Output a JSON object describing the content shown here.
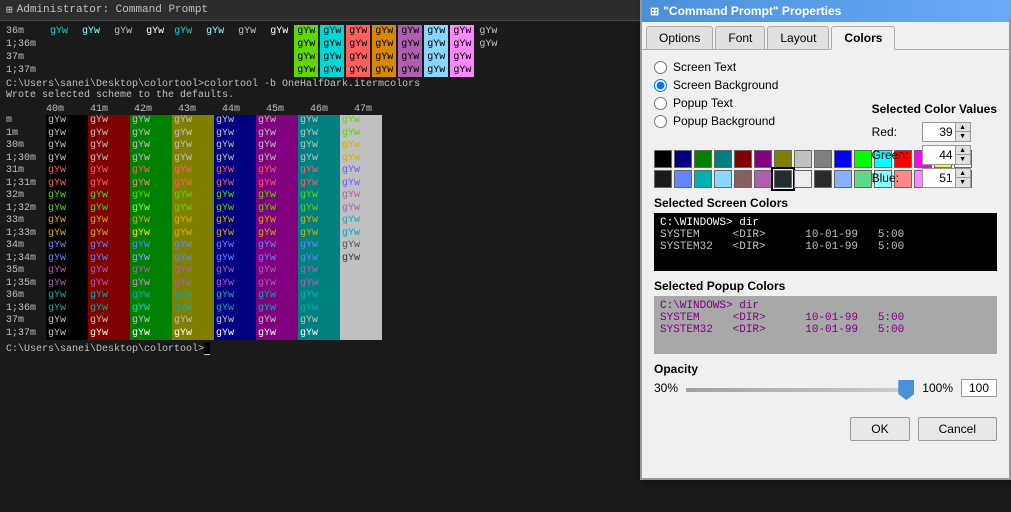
{
  "terminal": {
    "title": "Administrator: Command Prompt",
    "icon": "cmd-icon",
    "lines_top": [
      "36m",
      "1;36m",
      "37m",
      "1;37m"
    ],
    "cmd1": "C:\\Users\\sanei\\Desktop\\colortool>colortool -b OneHalfDark.itermcolors",
    "cmd2": "Wrote selected scheme to the defaults.",
    "column_headers": [
      "40m",
      "41m",
      "42m",
      "43m",
      "44m",
      "45m",
      "46m",
      "47m"
    ],
    "row_labels": [
      "m",
      "1m",
      "30m",
      "1;30m",
      "31m",
      "1;31m",
      "32m",
      "1;32m",
      "33m",
      "1;33m",
      "34m",
      "1;34m",
      "35m",
      "1;35m",
      "36m",
      "1;36m",
      "37m",
      "1;37m"
    ],
    "cursor_line": "C:\\Users\\sanei\\Desktop\\colortool>"
  },
  "dialog": {
    "title": "\"Command Prompt\" Properties",
    "icon": "properties-icon",
    "tabs": [
      "Options",
      "Font",
      "Layout",
      "Colors"
    ],
    "active_tab": "Colors",
    "radio_options": [
      {
        "id": "screen-text",
        "label": "Screen Text",
        "checked": false
      },
      {
        "id": "screen-background",
        "label": "Screen Background",
        "checked": true
      },
      {
        "id": "popup-text",
        "label": "Popup Text",
        "checked": false
      },
      {
        "id": "popup-background",
        "label": "Popup Background",
        "checked": false
      }
    ],
    "color_values": {
      "title": "Selected Color Values",
      "red": {
        "label": "Red:",
        "value": "39"
      },
      "green": {
        "label": "Green:",
        "value": "44"
      },
      "blue": {
        "label": "Blue:",
        "value": "51"
      }
    },
    "palette": {
      "row1": [
        "#000000",
        "#000080",
        "#008000",
        "#008080",
        "#800000",
        "#800080",
        "#808000",
        "#c0c0c0",
        "#808080",
        "#0000ff",
        "#00ff00",
        "#00ffff",
        "#ff0000",
        "#ff00ff",
        "#ffff00",
        "#ffffff"
      ],
      "row2": [
        "#888888",
        "#5f87ff",
        "#00afaf",
        "#87d7ff",
        "#875f5f",
        "#af5faf",
        "#5f8787",
        "#eeeeee",
        "#1a1a1a",
        "#87afff",
        "#5fd787",
        "#87ffff",
        "#ff8787",
        "#ff87ff",
        "#ffff87",
        "#f5f5f5"
      ]
    },
    "screen_colors": {
      "label": "Selected Screen Colors",
      "lines": [
        "C:\\WINDOWS> dir",
        "SYSTEM      <DIR>      10-01-99   5:00",
        "SYSTEM32    <DIR>      10-01-99   5:00"
      ]
    },
    "popup_colors": {
      "label": "Selected Popup Colors",
      "lines": [
        "C:\\WINDOWS> dir",
        "SYSTEM      <DIR>      10-01-99   5:00",
        "SYSTEM32    <DIR>      10-01-99   5:00"
      ]
    },
    "opacity": {
      "label": "Opacity",
      "min_label": "30%",
      "max_label": "100%",
      "value": "100",
      "slider_value": 100
    },
    "buttons": {
      "ok": "OK",
      "cancel": "Cancel"
    }
  }
}
